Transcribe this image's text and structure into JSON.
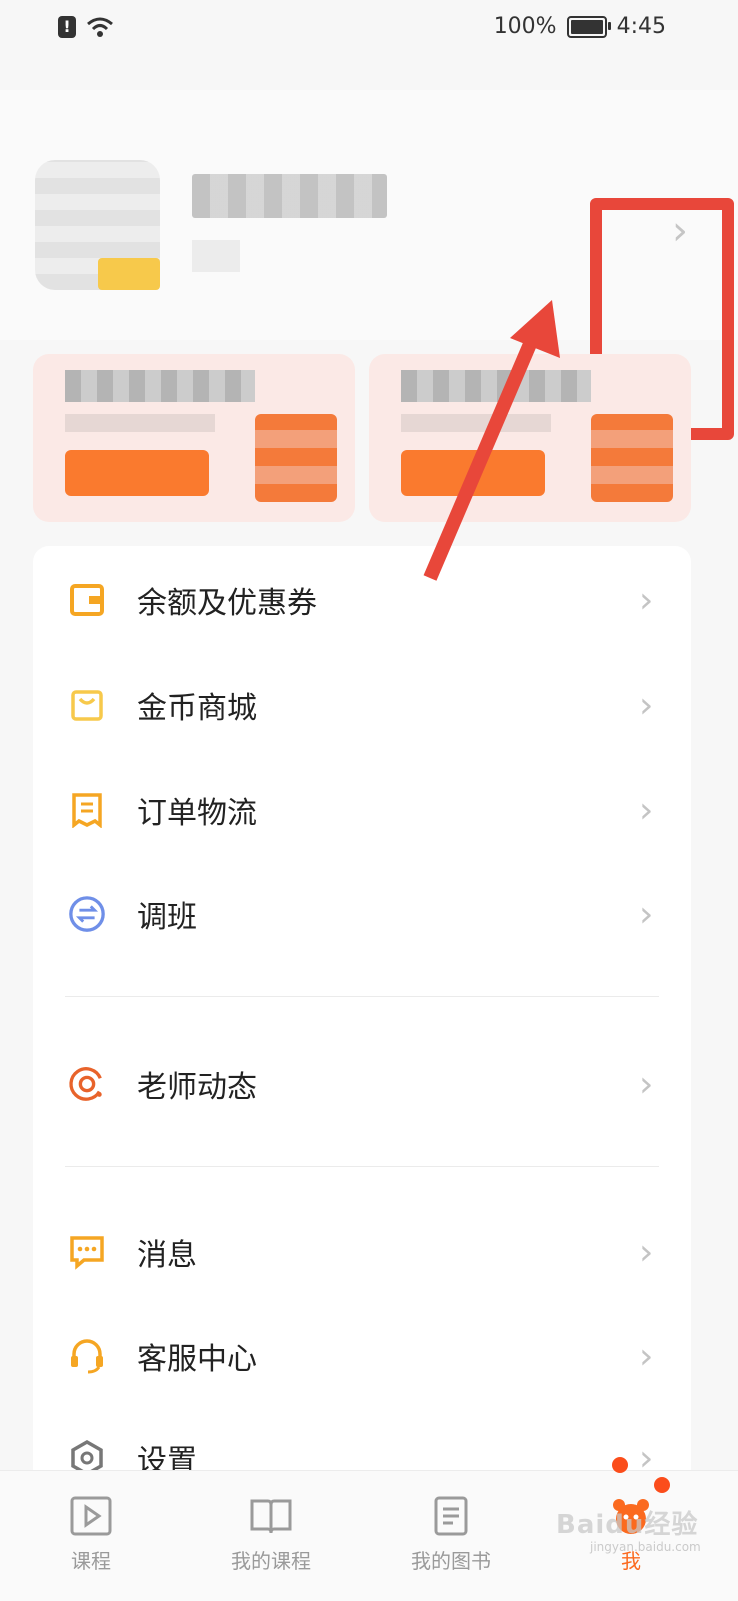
{
  "status_bar": {
    "battery": "100%",
    "time": "4:45"
  },
  "profile": {
    "name": "",
    "chevron": "›"
  },
  "menu": {
    "items": [
      {
        "label": "余额及优惠券",
        "icon": "wallet-icon"
      },
      {
        "label": "金币商城",
        "icon": "shopping-bag-icon"
      },
      {
        "label": "订单物流",
        "icon": "receipt-icon"
      },
      {
        "label": "调班",
        "icon": "swap-icon"
      },
      {
        "label": "老师动态",
        "icon": "radar-icon"
      },
      {
        "label": "消息",
        "icon": "message-icon"
      },
      {
        "label": "客服中心",
        "icon": "headset-icon"
      },
      {
        "label": "设置",
        "icon": "settings-icon"
      }
    ],
    "chevron": "›"
  },
  "tabs": [
    {
      "label": "课程",
      "icon": "play-icon",
      "active": false
    },
    {
      "label": "我的课程",
      "icon": "book-icon",
      "active": false
    },
    {
      "label": "我的图书",
      "icon": "document-icon",
      "active": false
    },
    {
      "label": "我",
      "icon": "mascot-icon",
      "active": true
    }
  ],
  "watermark": {
    "main": "Baidu经验",
    "sub": "jingyan.baidu.com"
  },
  "colors": {
    "accent": "#fb6a1f",
    "highlight": "#e8473a",
    "icon_orange": "#f5a623"
  }
}
